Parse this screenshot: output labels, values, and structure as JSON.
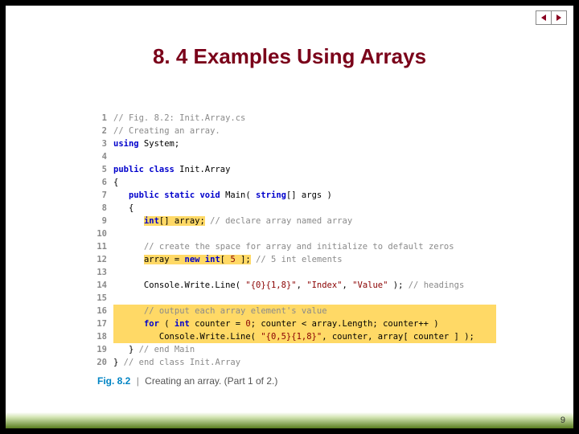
{
  "nav": {
    "prev": "prev",
    "next": "next"
  },
  "title": "8. 4 Examples Using Arrays",
  "code": {
    "lines": [
      {
        "ln": "1",
        "parts": [
          {
            "t": "// Fig. 8.2: Init.Array.cs",
            "cls": "c-comment"
          }
        ],
        "hl": ""
      },
      {
        "ln": "2",
        "parts": [
          {
            "t": "// Creating an array.",
            "cls": "c-comment"
          }
        ],
        "hl": ""
      },
      {
        "ln": "3",
        "parts": [
          {
            "t": "using",
            "cls": "c-kw"
          },
          {
            "t": " System;",
            "cls": ""
          }
        ],
        "hl": ""
      },
      {
        "ln": "4",
        "parts": [
          {
            "t": "",
            "cls": ""
          }
        ],
        "hl": ""
      },
      {
        "ln": "5",
        "parts": [
          {
            "t": "public class",
            "cls": "c-kw"
          },
          {
            "t": " Init.Array",
            "cls": ""
          }
        ],
        "hl": ""
      },
      {
        "ln": "6",
        "parts": [
          {
            "t": "{",
            "cls": ""
          }
        ],
        "hl": ""
      },
      {
        "ln": "7",
        "parts": [
          {
            "t": "   ",
            "cls": ""
          },
          {
            "t": "public static void",
            "cls": "c-kw"
          },
          {
            "t": " Main( ",
            "cls": ""
          },
          {
            "t": "string",
            "cls": "c-kw"
          },
          {
            "t": "[] args )",
            "cls": ""
          }
        ],
        "hl": ""
      },
      {
        "ln": "8",
        "parts": [
          {
            "t": "   {",
            "cls": ""
          }
        ],
        "hl": ""
      },
      {
        "ln": "9",
        "parts": [
          {
            "t": "      ",
            "cls": ""
          },
          {
            "t": "int",
            "cls": "c-kw",
            "inhl": "hl-yellow"
          },
          {
            "t": "[] array;",
            "cls": "",
            "inhl": "hl-yellow"
          },
          {
            "t": " ",
            "cls": ""
          },
          {
            "t": "// declare array named array",
            "cls": "c-comment"
          }
        ],
        "hl": ""
      },
      {
        "ln": "10",
        "parts": [
          {
            "t": "",
            "cls": ""
          }
        ],
        "hl": ""
      },
      {
        "ln": "11",
        "parts": [
          {
            "t": "      ",
            "cls": ""
          },
          {
            "t": "// create the space for array and initialize to default zeros",
            "cls": "c-comment"
          }
        ],
        "hl": ""
      },
      {
        "ln": "12",
        "parts": [
          {
            "t": "      ",
            "cls": ""
          },
          {
            "t": "array = ",
            "cls": "",
            "inhl": "hl-yellow"
          },
          {
            "t": "new int",
            "cls": "c-kw",
            "inhl": "hl-yellow"
          },
          {
            "t": "[ ",
            "cls": "",
            "inhl": "hl-yellow"
          },
          {
            "t": "5",
            "cls": "c-num",
            "inhl": "hl-yellow"
          },
          {
            "t": " ];",
            "cls": "",
            "inhl": "hl-yellow"
          },
          {
            "t": " ",
            "cls": ""
          },
          {
            "t": "// 5 int elements",
            "cls": "c-comment"
          }
        ],
        "hl": ""
      },
      {
        "ln": "13",
        "parts": [
          {
            "t": "",
            "cls": ""
          }
        ],
        "hl": ""
      },
      {
        "ln": "14",
        "parts": [
          {
            "t": "      Console.Write.Line( ",
            "cls": ""
          },
          {
            "t": "\"{0}{1,8}\"",
            "cls": "c-str"
          },
          {
            "t": ", ",
            "cls": ""
          },
          {
            "t": "\"Index\"",
            "cls": "c-str"
          },
          {
            "t": ", ",
            "cls": ""
          },
          {
            "t": "\"Value\"",
            "cls": "c-str"
          },
          {
            "t": " ); ",
            "cls": ""
          },
          {
            "t": "// headings",
            "cls": "c-comment"
          }
        ],
        "hl": ""
      },
      {
        "ln": "15",
        "parts": [
          {
            "t": "",
            "cls": ""
          }
        ],
        "hl": ""
      },
      {
        "ln": "16",
        "parts": [
          {
            "t": "      ",
            "cls": ""
          },
          {
            "t": "// output each array element's value",
            "cls": "c-comment"
          }
        ],
        "hl": "hl-yellow"
      },
      {
        "ln": "17",
        "parts": [
          {
            "t": "      ",
            "cls": ""
          },
          {
            "t": "for",
            "cls": "c-kw"
          },
          {
            "t": " ( ",
            "cls": ""
          },
          {
            "t": "int",
            "cls": "c-kw"
          },
          {
            "t": " counter = ",
            "cls": ""
          },
          {
            "t": "0",
            "cls": "c-num"
          },
          {
            "t": "; counter < array.Length; counter++ )",
            "cls": ""
          }
        ],
        "hl": "hl-yellow"
      },
      {
        "ln": "18",
        "parts": [
          {
            "t": "         Console.Write.Line( ",
            "cls": ""
          },
          {
            "t": "\"{0,5}{1,8}\"",
            "cls": "c-str"
          },
          {
            "t": ", counter, array[ counter ] );",
            "cls": ""
          }
        ],
        "hl": "hl-yellow"
      },
      {
        "ln": "19",
        "parts": [
          {
            "t": "   } ",
            "cls": ""
          },
          {
            "t": "// end Main",
            "cls": "c-comment"
          }
        ],
        "hl": ""
      },
      {
        "ln": "20",
        "parts": [
          {
            "t": "} ",
            "cls": ""
          },
          {
            "t": "// end class Init.Array",
            "cls": "c-comment"
          }
        ],
        "hl": ""
      }
    ]
  },
  "caption": {
    "label": "Fig. 8.2",
    "sep": "|",
    "text": "Creating an array. (Part 1 of 2.)"
  },
  "pagenum": "9"
}
